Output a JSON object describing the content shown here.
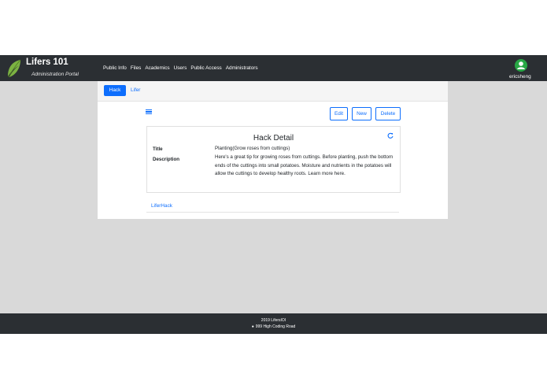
{
  "header": {
    "brand_title": "Lifers 101",
    "brand_subtitle": "Administration Portal",
    "nav": [
      "Public Info",
      "Files",
      "Academics",
      "Users",
      "Public Access",
      "Administrators"
    ],
    "user_name": "ericsheng"
  },
  "tabs": {
    "hack": "Hack",
    "lifer": "Lifer"
  },
  "toolbar": {
    "edit": "Edit",
    "new": "New",
    "delete": "Delete"
  },
  "detail": {
    "heading": "Hack Detail",
    "title_label": "Title",
    "title_value": "Planting(Grow roses from cuttings)",
    "description_label": "Description",
    "description_value": "Here's a great tip for growing roses from cuttings. Before planting, push the bottom ends of the cuttings into small potatoes. Moisture and nutrients in the potatoes will allow the cuttings to develop healthy roots. Learn more here."
  },
  "related": {
    "link": "LiferHack"
  },
  "footer": {
    "line1": "2019 LifersIOI",
    "line2": "999 High Coding Road"
  },
  "colors": {
    "primary": "#0d6efd",
    "header_bg": "#2b2f33",
    "content_bg": "#d9d9d9",
    "avatar": "#28a745",
    "leaf": "#7cb342"
  }
}
